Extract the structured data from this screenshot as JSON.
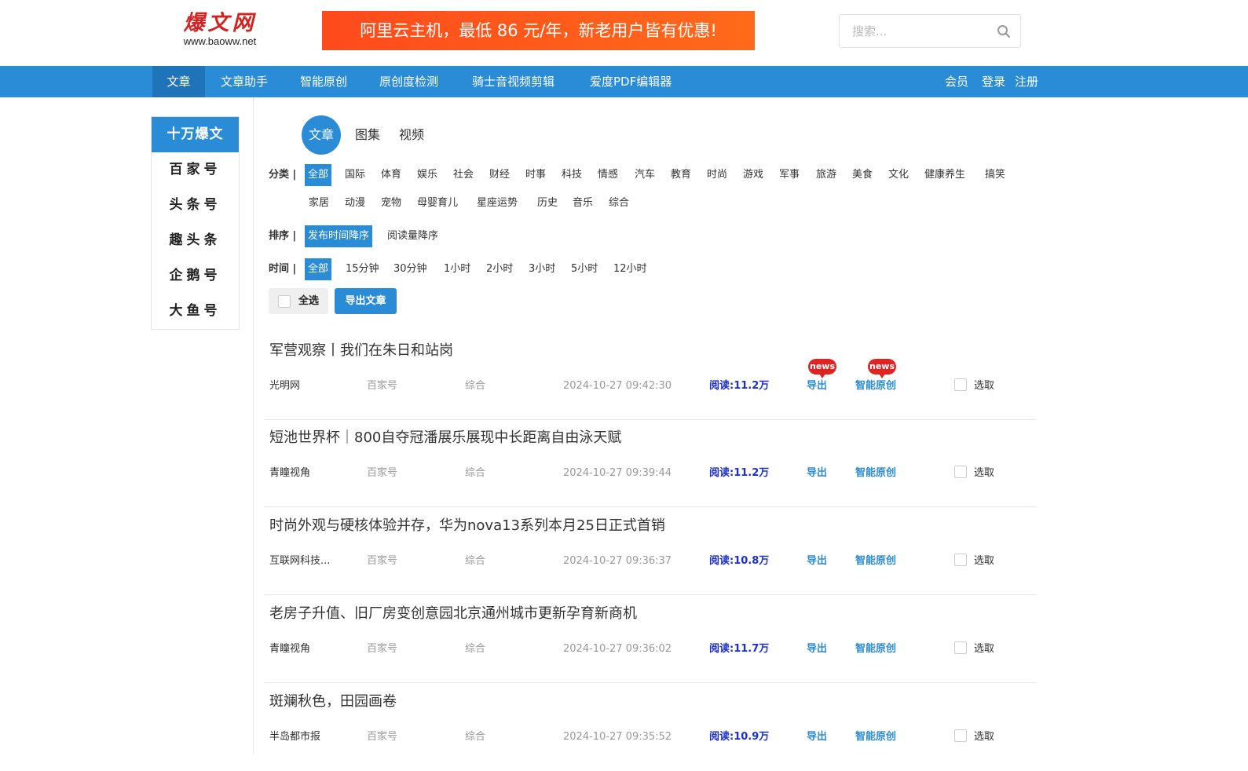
{
  "header": {
    "logo_main": "爆文网",
    "logo_sub": "www.baoww.net",
    "ad_text": "阿里云主机，最低 86 元/年，新老用户皆有优惠!",
    "search_placeholder": "搜索..."
  },
  "nav": {
    "items": [
      "文章",
      "文章助手",
      "智能原创",
      "原创度检测",
      "骑士音视频剪辑",
      "爱度PDF编辑器"
    ],
    "right": [
      "会员",
      "登录",
      "注册"
    ]
  },
  "sidebar": {
    "items": [
      "十万爆文",
      "百家号",
      "头条号",
      "趣头条",
      "企鹅号",
      "大鱼号"
    ]
  },
  "content_types": [
    "文章",
    "图集",
    "视频"
  ],
  "filters": {
    "category_label": "分类 |",
    "categories_row1": [
      "全部",
      "国际",
      "体育",
      "娱乐",
      "社会",
      "财经",
      "时事",
      "科技",
      "情感",
      "汽车",
      "教育",
      "时尚",
      "游戏",
      "军事",
      "旅游",
      "美食",
      "文化",
      "健康养生",
      "搞笑"
    ],
    "categories_row2": [
      "家居",
      "动漫",
      "宠物",
      "母婴育儿",
      "星座运势",
      "历史",
      "音乐",
      "综合"
    ],
    "sort_label": "排序 |",
    "sort_options": [
      "发布时间降序",
      "阅读量降序"
    ],
    "time_label": "时间 |",
    "time_options": [
      "全部",
      "15分钟",
      "30分钟",
      "1小时",
      "2小时",
      "3小时",
      "5小时",
      "12小时"
    ]
  },
  "actions": {
    "select_all": "全选",
    "export_articles": "导出文章"
  },
  "articles": [
    {
      "title": "军营观察丨我们在朱日和站岗",
      "source": "光明网",
      "platform": "百家号",
      "category": "综合",
      "time": "2024-10-27 09:42:30",
      "reads": "阅读:11.2万",
      "export": "导出",
      "ai": "智能原创",
      "pick": "选取",
      "badge": "news"
    },
    {
      "title": "短池世界杯｜800自夺冠潘展乐展现中长距离自由泳天赋",
      "source": "青瞳视角",
      "platform": "百家号",
      "category": "综合",
      "time": "2024-10-27 09:39:44",
      "reads": "阅读:11.2万",
      "export": "导出",
      "ai": "智能原创",
      "pick": "选取"
    },
    {
      "title": "时尚外观与硬核体验并存，华为nova13系列本月25日正式首销",
      "source": "互联网科技...",
      "platform": "百家号",
      "category": "综合",
      "time": "2024-10-27 09:36:37",
      "reads": "阅读:10.8万",
      "export": "导出",
      "ai": "智能原创",
      "pick": "选取"
    },
    {
      "title": "老房子升值、旧厂房变创意园北京通州城市更新孕育新商机",
      "source": "青瞳视角",
      "platform": "百家号",
      "category": "综合",
      "time": "2024-10-27 09:36:02",
      "reads": "阅读:11.7万",
      "export": "导出",
      "ai": "智能原创",
      "pick": "选取"
    },
    {
      "title": "斑斓秋色，田园画卷",
      "source": "半岛都市报",
      "platform": "百家号",
      "category": "综合",
      "time": "2024-10-27 09:35:52",
      "reads": "阅读:10.9万",
      "export": "导出",
      "ai": "智能原创",
      "pick": "选取"
    }
  ]
}
